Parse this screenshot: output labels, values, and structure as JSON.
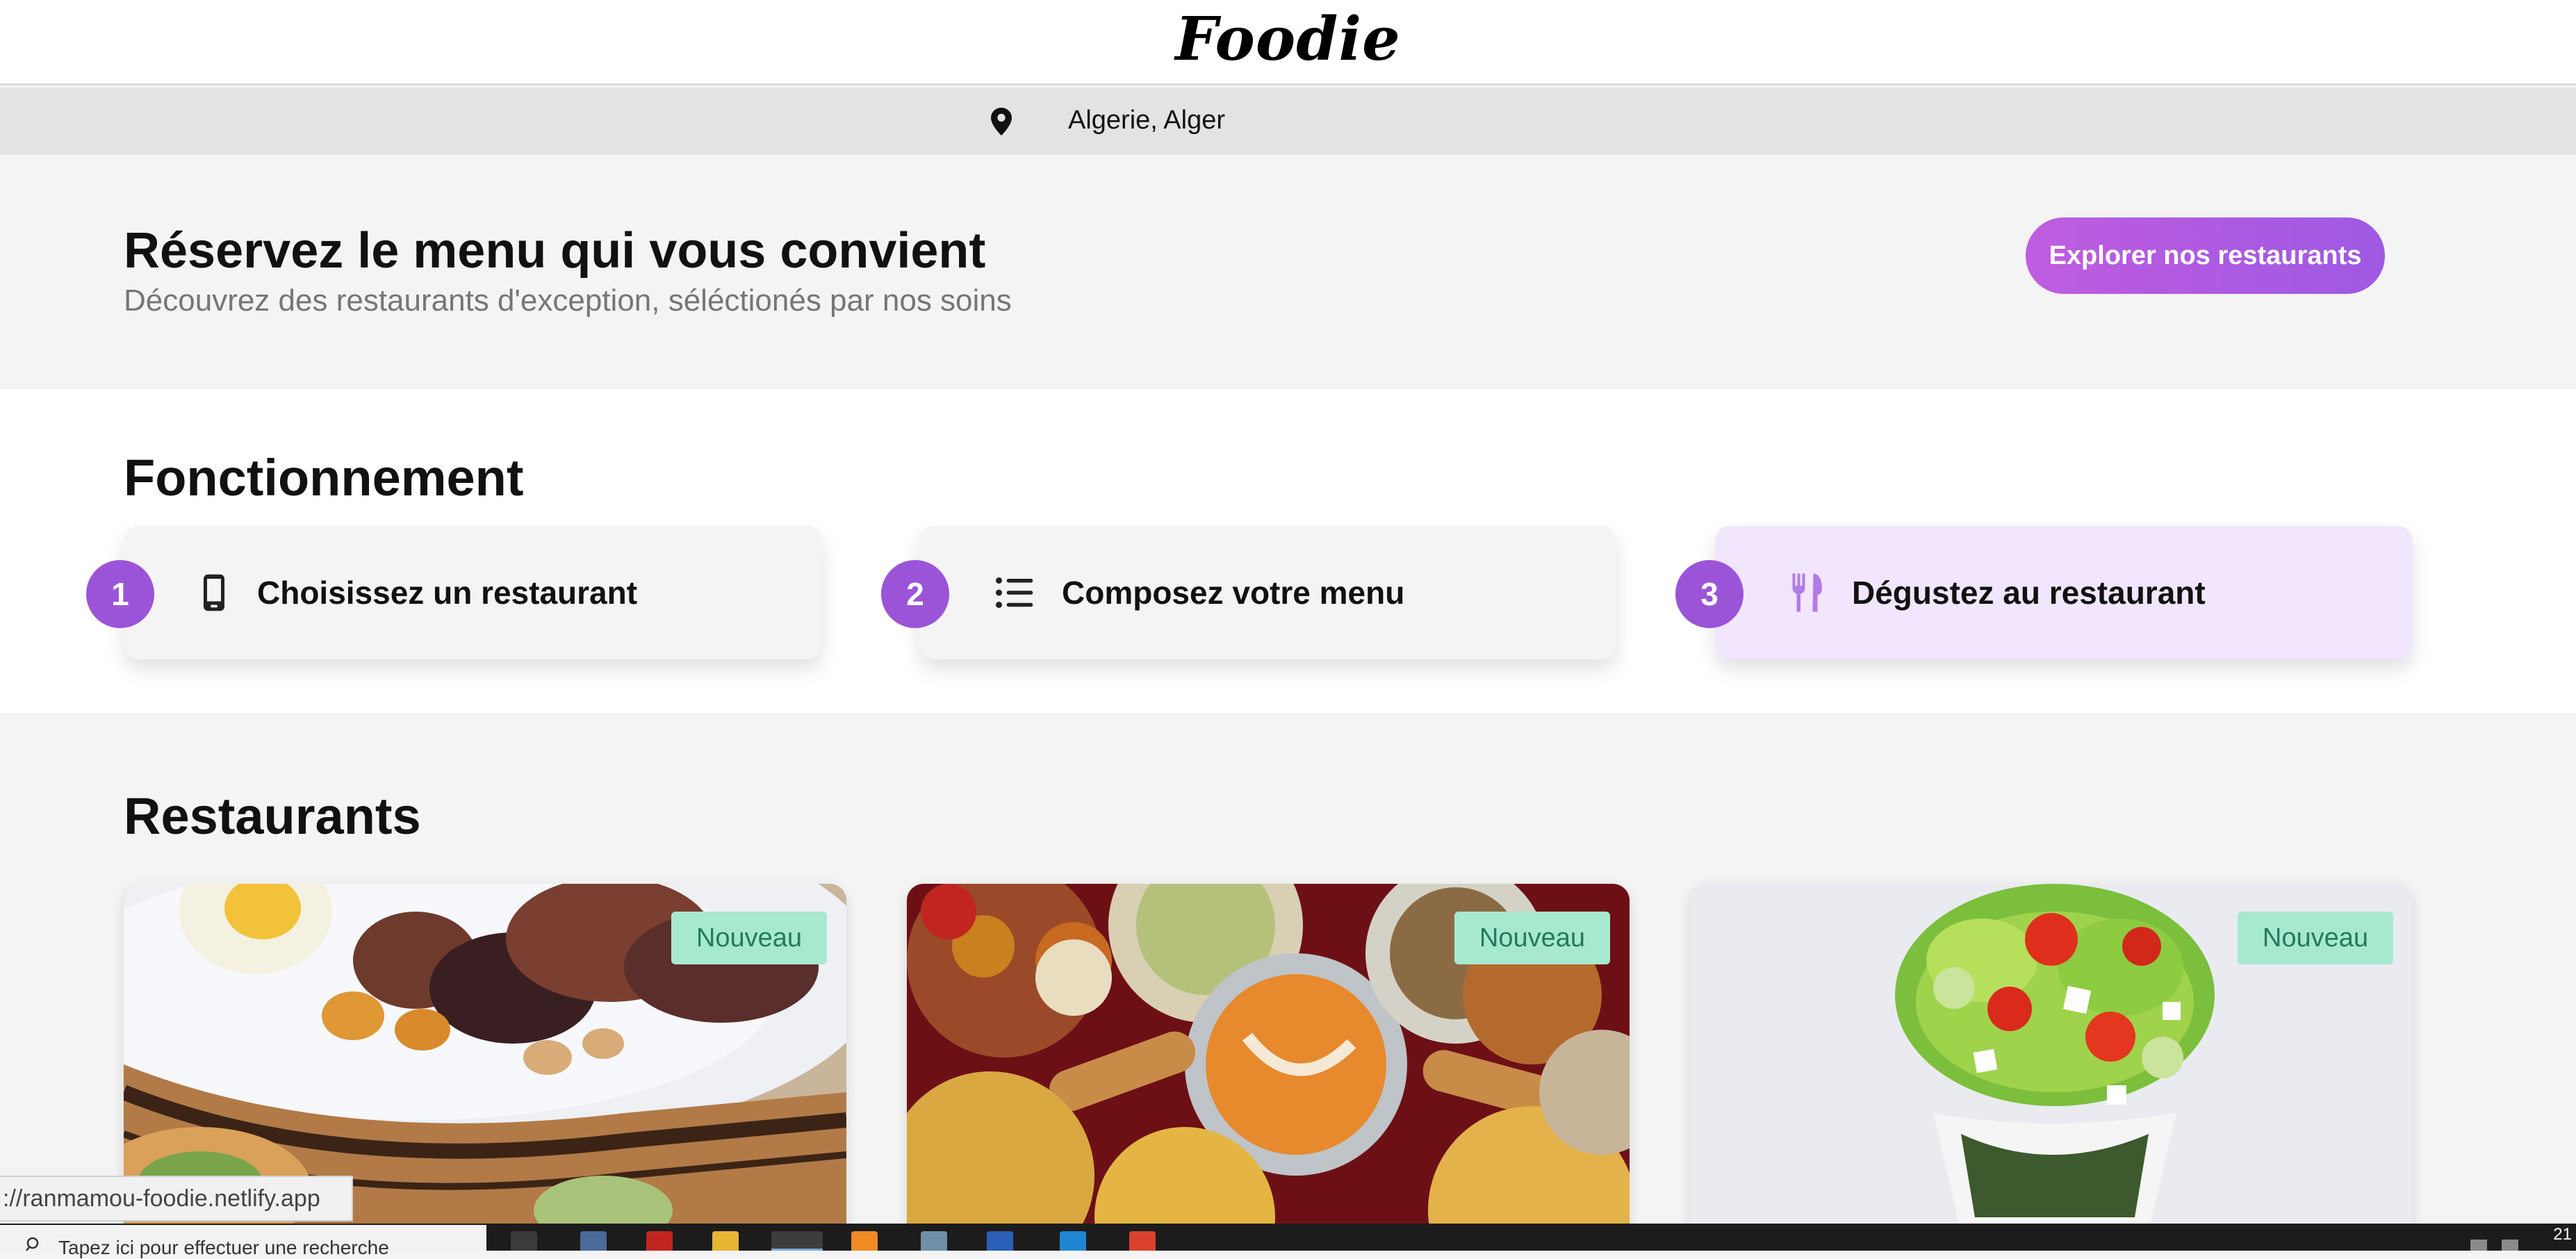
{
  "header": {
    "logo": "Foodie"
  },
  "location": {
    "icon": "map-pin-icon",
    "text": "Algerie, Alger"
  },
  "hero": {
    "title": "Réservez le menu qui vous convient",
    "subtitle": "Découvrez des restaurants d'exception, séléctionés par nos soins",
    "cta_label": "Explorer nos restaurants"
  },
  "how_it_works": {
    "title": "Fonctionnement",
    "steps": [
      {
        "number": "1",
        "icon": "smartphone-icon",
        "label": "Choisissez un restaurant"
      },
      {
        "number": "2",
        "icon": "list-icon",
        "label": "Composez votre menu"
      },
      {
        "number": "3",
        "icon": "utensils-icon",
        "label": "Dégustez au restaurant"
      }
    ]
  },
  "restaurants": {
    "title": "Restaurants",
    "cards": [
      {
        "badge": "Nouveau",
        "image": "tajine-dish-photo"
      },
      {
        "badge": "Nouveau",
        "image": "indian-platter-photo"
      },
      {
        "badge": "Nouveau",
        "image": "salad-bowl-photo"
      }
    ]
  },
  "status_bar": {
    "url": "://ranmamou-foodie.netlify.app"
  },
  "taskbar": {
    "search_placeholder": "Tapez ici pour effectuer une recherche",
    "clock": "21"
  },
  "colors": {
    "accent": "#9b54d8",
    "cta_gradient_start": "#c05ce0",
    "cta_gradient_end": "#9e59e3",
    "badge_bg": "#a6e9cf",
    "badge_text": "#257a5a",
    "active_step_bg": "#f1e6fd"
  }
}
